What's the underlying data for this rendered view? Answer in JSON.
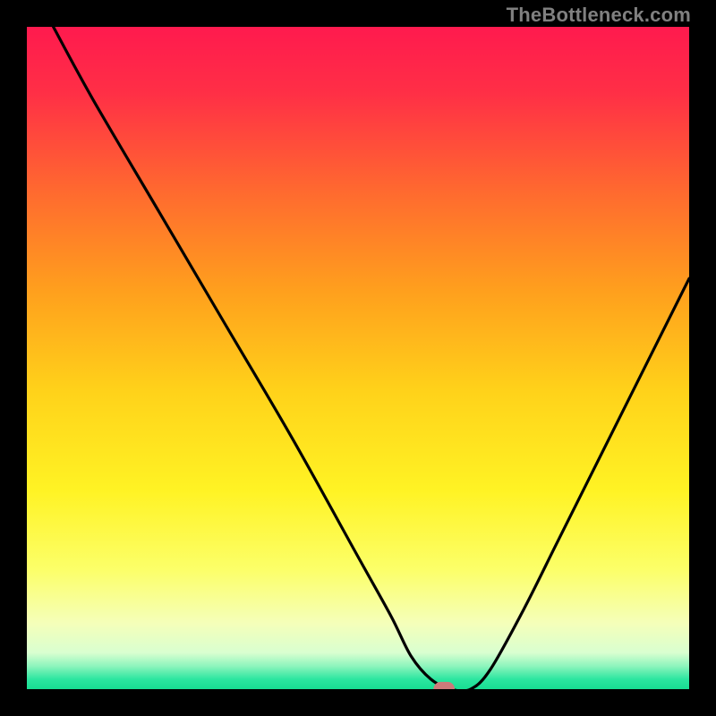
{
  "watermark": "TheBottleneck.com",
  "chart_data": {
    "type": "line",
    "title": "",
    "xlabel": "",
    "ylabel": "",
    "xlim": [
      0,
      100
    ],
    "ylim": [
      0,
      100
    ],
    "grid": false,
    "legend": false,
    "series": [
      {
        "name": "bottleneck-curve",
        "x": [
          4,
          10,
          20,
          30,
          40,
          50,
          55,
          58,
          61,
          64,
          67,
          70,
          75,
          80,
          85,
          90,
          95,
          100
        ],
        "values": [
          100,
          89,
          72,
          55,
          38,
          20,
          11,
          5,
          1.5,
          0,
          0,
          3,
          12,
          22,
          32,
          42,
          52,
          62
        ]
      }
    ],
    "marker": {
      "name": "optimal-marker",
      "x": 63,
      "y": 0,
      "color": "#cd7a7a",
      "width": 3.2,
      "height": 2.2
    },
    "gradient_stops": [
      {
        "offset": 0.0,
        "color": "#ff1a4e"
      },
      {
        "offset": 0.1,
        "color": "#ff2f46"
      },
      {
        "offset": 0.25,
        "color": "#ff6a2f"
      },
      {
        "offset": 0.4,
        "color": "#ffa01d"
      },
      {
        "offset": 0.55,
        "color": "#ffd21a"
      },
      {
        "offset": 0.7,
        "color": "#fff324"
      },
      {
        "offset": 0.82,
        "color": "#fcff69"
      },
      {
        "offset": 0.9,
        "color": "#f5ffb9"
      },
      {
        "offset": 0.945,
        "color": "#d9ffd0"
      },
      {
        "offset": 0.965,
        "color": "#8ef5bd"
      },
      {
        "offset": 0.985,
        "color": "#2ce6a0"
      },
      {
        "offset": 1.0,
        "color": "#18dd92"
      }
    ]
  }
}
